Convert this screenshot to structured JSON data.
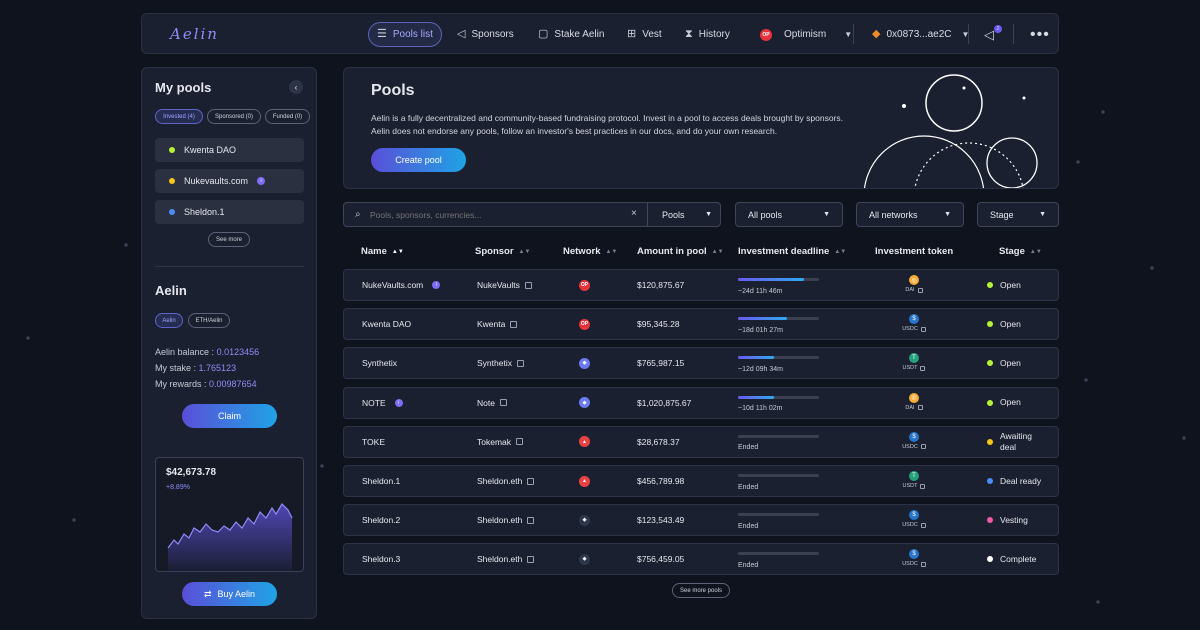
{
  "nav": {
    "logo": "Aelin",
    "items": [
      {
        "label": "Pools list",
        "icon": "list-icon"
      },
      {
        "label": "Sponsors",
        "icon": "megaphone-icon"
      },
      {
        "label": "Stake Aelin",
        "icon": "lock-icon"
      },
      {
        "label": "Vest",
        "icon": "gift-icon"
      },
      {
        "label": "History",
        "icon": "hourglass-icon"
      }
    ],
    "network": "Optimism",
    "network_abbr": "OP",
    "wallet": "0x0873...ae2C",
    "notification_count": "2"
  },
  "sidebar": {
    "title": "My pools",
    "filters": [
      "Invested (4)",
      "Sponsored (0)",
      "Funded (0)"
    ],
    "pools": [
      {
        "name": "Kwenta DAO",
        "color": "#b5f23a"
      },
      {
        "name": "Nukevaults.com",
        "color": "#f5c518",
        "badge": "i"
      },
      {
        "name": "Sheldon.1",
        "color": "#4a8ef5"
      }
    ],
    "see_more": "See more",
    "aelin": {
      "title": "Aelin",
      "tabs": [
        "Aelin",
        "ETH/Aelin"
      ],
      "balance_label": "Aelin balance :",
      "balance_value": "0.0123456",
      "stake_label": "My stake :",
      "stake_value": "1.765123",
      "rewards_label": "My rewards :",
      "rewards_value": "0.00987654",
      "claim": "Claim"
    },
    "price": {
      "value": "$42,673.78",
      "change": "+8.89%"
    },
    "buy": "Buy Aelin"
  },
  "hero": {
    "title": "Pools",
    "description": "Aelin is a fully decentralized and community-based fundraising protocol. Invest in a pool to access deals brought by sponsors. Aelin does not endorse any pools, follow an investor's best practices in our docs, and do your own research.",
    "create": "Create pool"
  },
  "filters": {
    "search_placeholder": "Pools, sponsors, currencies...",
    "search_scope": "Pools",
    "pools": "All pools",
    "networks": "All networks",
    "stage": "Stage"
  },
  "table": {
    "headers": [
      "Name",
      "Sponsor",
      "Network",
      "Amount in pool",
      "Investment deadline",
      "Investment token",
      "Stage"
    ],
    "rows": [
      {
        "name": "NukeVaults.com",
        "badge": true,
        "sponsor": "NukeVaults",
        "network": "op",
        "amount": "$120,875.67",
        "deadline": "~24d 11h 46m",
        "progress": 0.82,
        "token": "DAI",
        "stage": "Open",
        "stage_color": "#b5f23a"
      },
      {
        "name": "Kwenta DAO",
        "badge": false,
        "sponsor": "Kwenta",
        "network": "op",
        "amount": "$95,345.28",
        "deadline": "~18d 01h 27m",
        "progress": 0.6,
        "token": "USDC",
        "stage": "Open",
        "stage_color": "#b5f23a"
      },
      {
        "name": "Synthetix",
        "badge": false,
        "sponsor": "Synthetix",
        "network": "eth",
        "amount": "$765,987.15",
        "deadline": "~12d 09h 34m",
        "progress": 0.45,
        "token": "USDT",
        "stage": "Open",
        "stage_color": "#b5f23a"
      },
      {
        "name": "NOTE",
        "badge": true,
        "sponsor": "Note",
        "network": "eth",
        "amount": "$1,020,875.67",
        "deadline": "~10d 11h 02m",
        "progress": 0.45,
        "token": "DAI",
        "stage": "Open",
        "stage_color": "#b5f23a"
      },
      {
        "name": "TOKE",
        "badge": false,
        "sponsor": "Tokemak",
        "network": "avax",
        "amount": "$28,678.37",
        "deadline": "Ended",
        "progress": 0,
        "token": "USDC",
        "stage": "Awaiting deal",
        "stage_color": "#f5c518"
      },
      {
        "name": "Sheldon.1",
        "badge": false,
        "sponsor": "Sheldon.eth",
        "network": "avax",
        "amount": "$456,789.98",
        "deadline": "Ended",
        "progress": 0,
        "token": "USDT",
        "stage": "Deal ready",
        "stage_color": "#4a8ef5"
      },
      {
        "name": "Sheldon.2",
        "badge": false,
        "sponsor": "Sheldon.eth",
        "network": "arb",
        "amount": "$123,543.49",
        "deadline": "Ended",
        "progress": 0,
        "token": "USDC",
        "stage": "Vesting",
        "stage_color": "#f05aa8"
      },
      {
        "name": "Sheldon.3",
        "badge": false,
        "sponsor": "Sheldon.eth",
        "network": "arb",
        "amount": "$756,459.05",
        "deadline": "Ended",
        "progress": 0,
        "token": "USDC",
        "stage": "Complete",
        "stage_color": "#ffffff"
      }
    ],
    "see_more": "See more pools"
  },
  "colors": {
    "accent": "#8f8cf8",
    "positive": "#b5f23a"
  }
}
